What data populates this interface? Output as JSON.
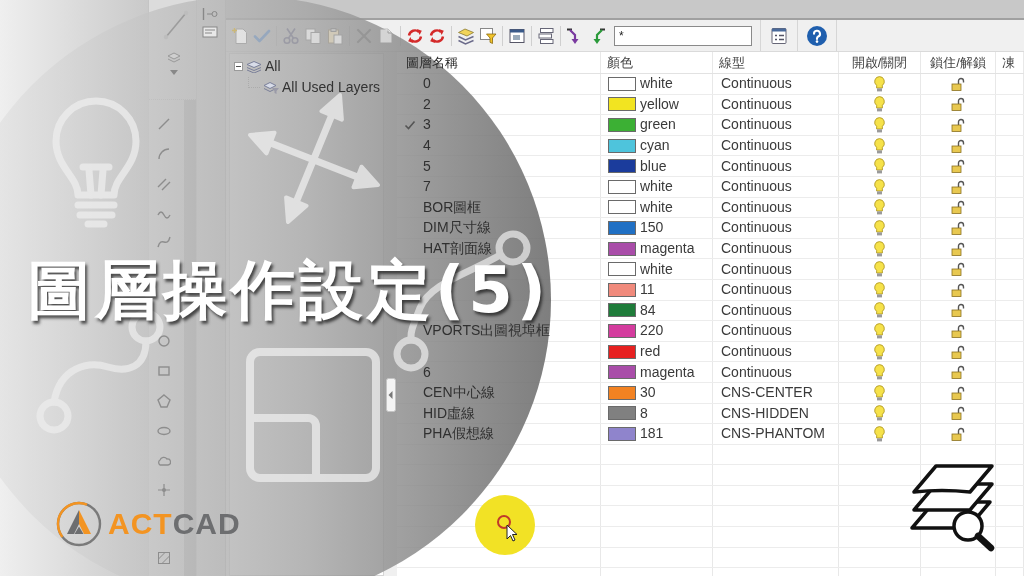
{
  "title": "圖層操作設定(5)",
  "logo": {
    "wordmark": [
      {
        "text": "ACT",
        "color": "#f39422"
      },
      {
        "text": "CAD",
        "color": "#6d6e70"
      }
    ]
  },
  "layer_dialog": {
    "filter_field": {
      "value": "*"
    },
    "filter_tree": [
      {
        "label": "All",
        "expanded": true,
        "children": [
          {
            "label": "All Used Layers"
          }
        ]
      }
    ],
    "table": {
      "columns": [
        "圖層名稱",
        "顏色",
        "線型",
        "開啟/關閉",
        "鎖住/解鎖",
        "凍"
      ],
      "rows": [
        {
          "name": "0",
          "current": false,
          "color_name": "white",
          "color": "#ffffff",
          "linetype": "Continuous",
          "on": true,
          "locked": false
        },
        {
          "name": "2",
          "current": false,
          "color_name": "yellow",
          "color": "#f2e421",
          "linetype": "Continuous",
          "on": true,
          "locked": false
        },
        {
          "name": "3",
          "current": true,
          "color_name": "green",
          "color": "#3cb034",
          "linetype": "Continuous",
          "on": true,
          "locked": false
        },
        {
          "name": "4",
          "current": false,
          "color_name": "cyan",
          "color": "#4ec4dc",
          "linetype": "Continuous",
          "on": true,
          "locked": false
        },
        {
          "name": "5",
          "current": false,
          "color_name": "blue",
          "color": "#1b3c9c",
          "linetype": "Continuous",
          "on": true,
          "locked": false
        },
        {
          "name": "7",
          "current": false,
          "color_name": "white",
          "color": "#ffffff",
          "linetype": "Continuous",
          "on": true,
          "locked": false
        },
        {
          "name": "BOR圖框",
          "current": false,
          "color_name": "white",
          "color": "#ffffff",
          "linetype": "Continuous",
          "on": true,
          "locked": false
        },
        {
          "name": "DIM尺寸線",
          "current": false,
          "color_name": "150",
          "color": "#2070c4",
          "linetype": "Continuous",
          "on": true,
          "locked": false
        },
        {
          "name": "HAT剖面線",
          "current": false,
          "color_name": "magenta",
          "color": "#a94da9",
          "linetype": "Continuous",
          "on": true,
          "locked": false
        },
        {
          "current": false,
          "color_name": "white",
          "color": "#ffffff",
          "linetype": "Continuous",
          "on": true,
          "locked": false
        },
        {
          "current": false,
          "color_name": "11",
          "color": "#f08a7c",
          "linetype": "Continuous",
          "on": true,
          "locked": false
        },
        {
          "current": false,
          "color_name": "84",
          "color": "#1f7c3a",
          "linetype": "Continuous",
          "on": true,
          "locked": false
        },
        {
          "name": "VPORTS出圖視埠框",
          "current": false,
          "color_name": "220",
          "color": "#d43c9e",
          "linetype": "Continuous",
          "on": true,
          "locked": false
        },
        {
          "current": false,
          "color_name": "red",
          "color": "#e62020",
          "linetype": "Continuous",
          "on": true,
          "locked": false
        },
        {
          "name": "6",
          "current": false,
          "color_name": "magenta",
          "color": "#a94da9",
          "linetype": "Continuous",
          "on": true,
          "locked": false
        },
        {
          "name": "CEN中心線",
          "current": false,
          "color_name": "30",
          "color": "#f28222",
          "linetype": "CNS-CENTER",
          "on": true,
          "locked": false
        },
        {
          "name": "HID虛線",
          "current": false,
          "color_name": "8",
          "color": "#808080",
          "linetype": "CNS-HIDDEN",
          "on": true,
          "locked": false
        },
        {
          "name": "PHA假想線",
          "current": false,
          "color_name": "181",
          "color": "#8f84cc",
          "linetype": "CNS-PHANTOM",
          "on": true,
          "locked": false
        }
      ]
    }
  }
}
